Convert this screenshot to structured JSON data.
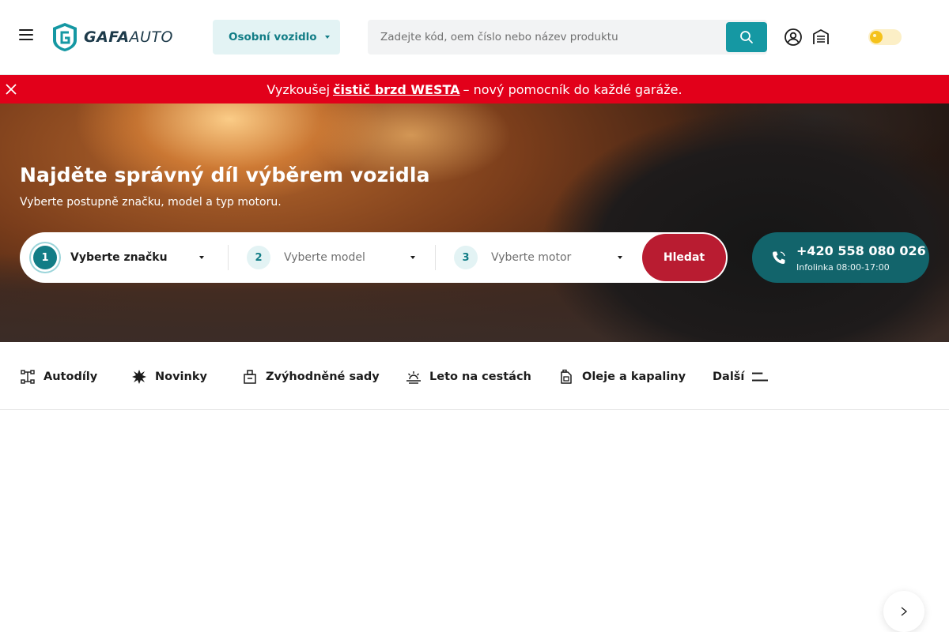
{
  "header": {
    "logo": {
      "brand_bold": "GAFA",
      "brand_thin": "AUTO"
    },
    "vehicle_type": {
      "label": "Osobní vozidlo"
    },
    "search": {
      "placeholder": "Zadejte kód, oem číslo nebo název produktu"
    },
    "icons": [
      "menu-icon",
      "search-icon",
      "account-icon",
      "garage-icon",
      "theme-toggle"
    ]
  },
  "promo": {
    "prefix": "Vyzkoušej",
    "link": "čistič brzd WESTA",
    "suffix": "– nový pomocník do každé garáže."
  },
  "hero": {
    "title": "Najděte správný díl výběrem vozidla",
    "subtitle": "Vyberte postupně značku, model a typ motoru.",
    "steps": [
      {
        "number": "1",
        "label": "Vyberte značku"
      },
      {
        "number": "2",
        "label": "Vyberte model"
      },
      {
        "number": "3",
        "label": "Vyberte motor"
      }
    ],
    "search_button": "Hledat",
    "hotline": {
      "phone": "+420 558 080 026",
      "hours": "Infolinka 08:00-17:00"
    }
  },
  "categories": [
    {
      "label": "Autodíly",
      "icon": "chassis-icon"
    },
    {
      "label": "Novinky",
      "icon": "starburst-icon"
    },
    {
      "label": "Zvýhodněné sady",
      "icon": "kit-box-icon"
    },
    {
      "label": "Leto na cestách",
      "icon": "sunset-icon"
    },
    {
      "label": "Oleje a kapaliny",
      "icon": "oil-canister-icon"
    },
    {
      "label": "Další",
      "icon": "more-lines-icon"
    }
  ],
  "colors": {
    "primary_teal": "#1598a3",
    "dark_teal": "#12646b",
    "promo_red": "#e2001a",
    "search_red": "#b91c31"
  }
}
